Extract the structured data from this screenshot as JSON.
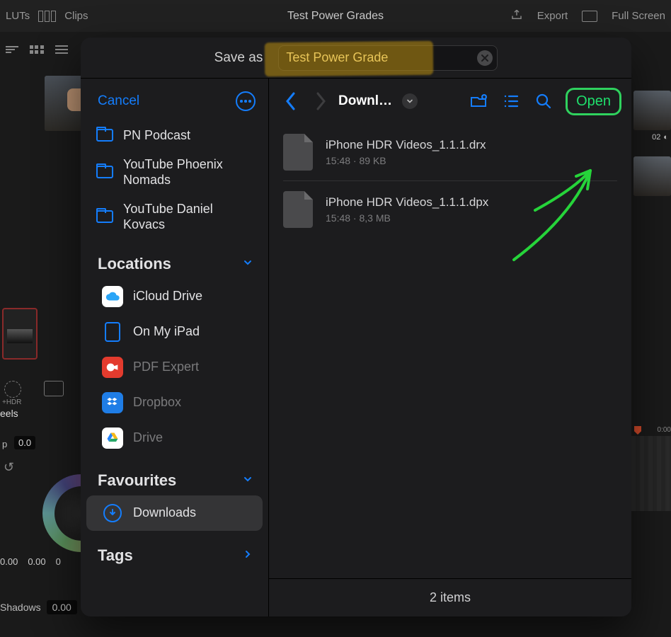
{
  "bg": {
    "luts": "LUTs",
    "clips": "Clips",
    "title": "Test Power Grades",
    "export": "Export",
    "fullscreen": "Full Screen",
    "hdr": "+HDR",
    "eels": "eels",
    "label_p": "p",
    "field0": "0.0",
    "valrow": [
      "0.00",
      "0.00",
      "0"
    ],
    "shadows_label": "Shadows",
    "shadows_val": "0.00",
    "thumb_label_num": "02",
    "timeline_tick": "0:00"
  },
  "modal": {
    "save_as_label": "Save as",
    "filename": "Test Power Grade",
    "sidebar": {
      "cancel": "Cancel",
      "folders": [
        {
          "label": "PN Podcast"
        },
        {
          "label": "YouTube Phoenix Nomads"
        },
        {
          "label": "YouTube Daniel Kovacs"
        }
      ],
      "locations_title": "Locations",
      "locations": [
        {
          "id": "icloud",
          "label": "iCloud Drive",
          "dim": false
        },
        {
          "id": "ipad",
          "label": "On My iPad",
          "dim": false
        },
        {
          "id": "pdf",
          "label": "PDF Expert",
          "dim": true
        },
        {
          "id": "dropbox",
          "label": "Dropbox",
          "dim": true
        },
        {
          "id": "drive",
          "label": "Drive",
          "dim": true
        }
      ],
      "favourites_title": "Favourites",
      "favourites": [
        {
          "id": "downloads",
          "label": "Downloads",
          "selected": true
        }
      ],
      "tags_title": "Tags"
    },
    "browser": {
      "breadcrumb": "Downl…",
      "open": "Open",
      "files": [
        {
          "name": "iPhone HDR Videos_1.1.1.drx",
          "sub": "15:48 · 89 KB"
        },
        {
          "name": "iPhone HDR Videos_1.1.1.dpx",
          "sub": "15:48 · 8,3 MB"
        }
      ],
      "footer": "2 items"
    }
  }
}
